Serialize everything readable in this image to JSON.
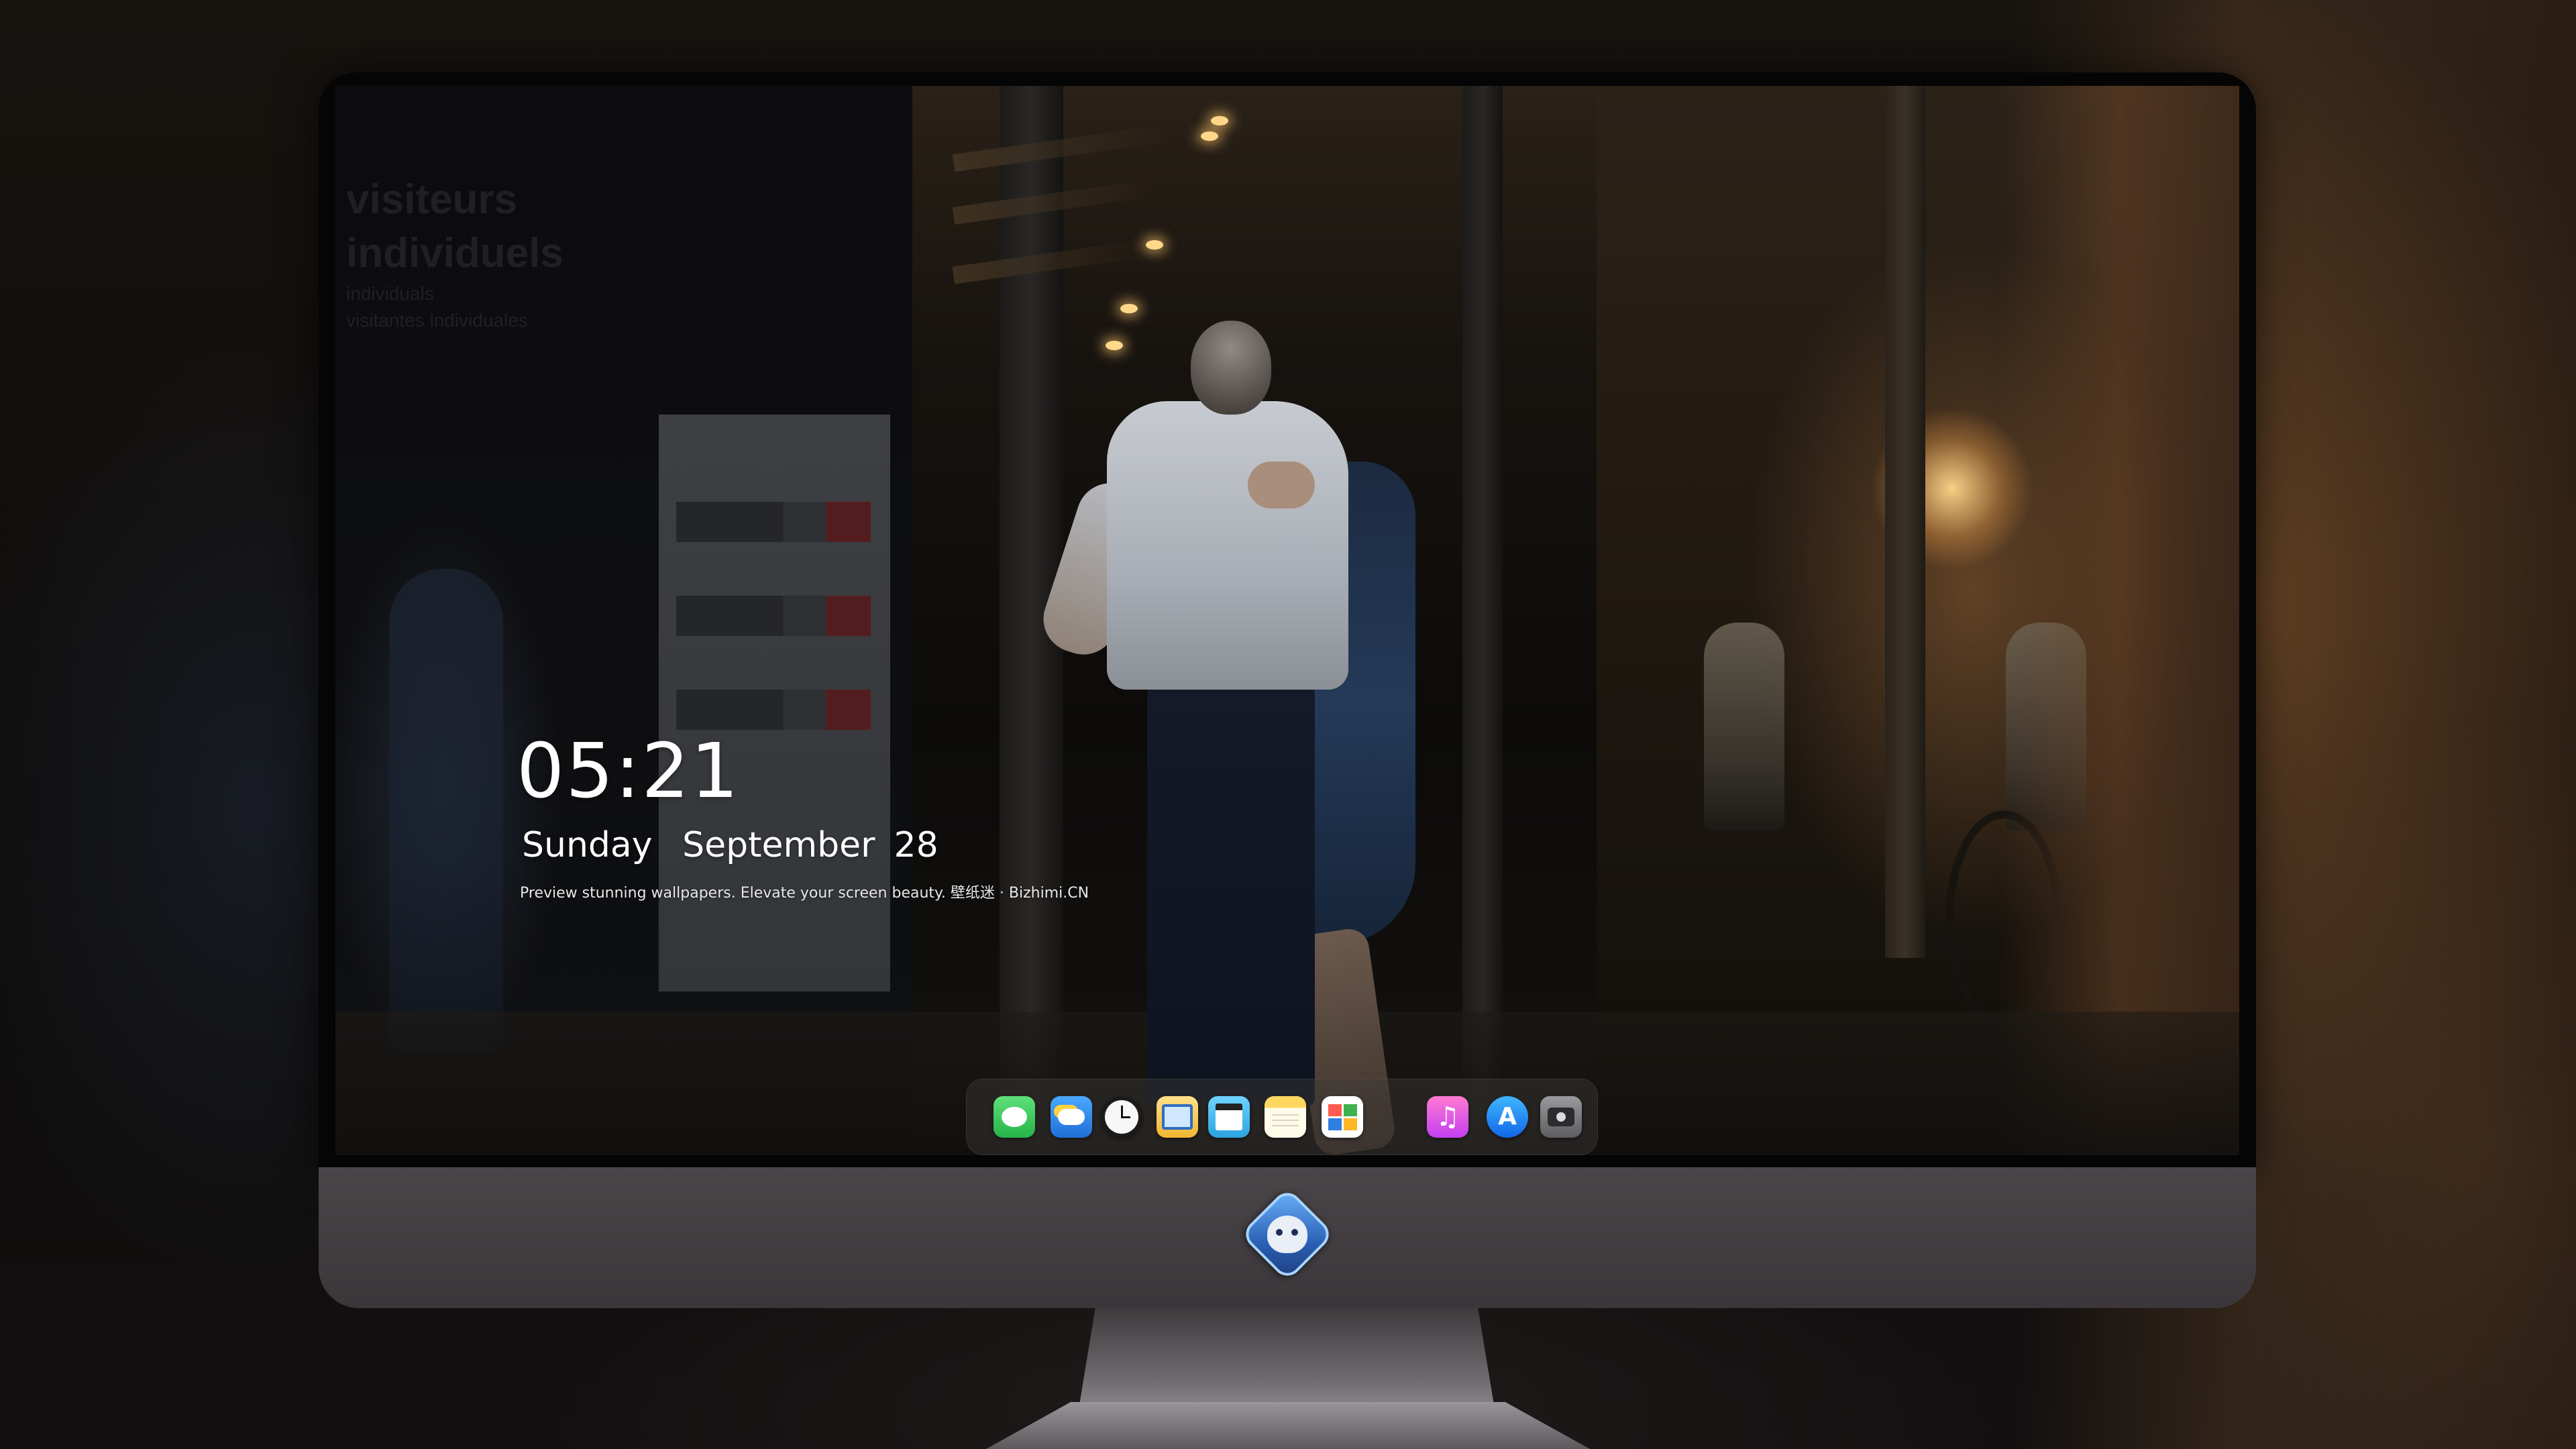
{
  "lock_screen": {
    "time": "05:21",
    "weekday": "Sunday",
    "month": "September",
    "day": "28",
    "tagline": "Preview stunning wallpapers. Elevate your screen beauty. 壁纸迷 · Bizhimi.CN"
  },
  "wallpaper": {
    "sign_text_line1": "visiteurs",
    "sign_text_line2": "individuels",
    "sign_text_line3": "individuals",
    "sign_text_line4": "visitantes individuales"
  },
  "dock": {
    "items": [
      {
        "name": "messages",
        "icon": "message-bubble-icon",
        "color": "#34c759"
      },
      {
        "name": "weather",
        "icon": "cloud-sun-icon",
        "color": "#2f8cf0"
      },
      {
        "name": "clock",
        "icon": "clock-icon",
        "color": "#f2f2f2"
      },
      {
        "name": "preview",
        "icon": "preview-icon",
        "color": "#f5c542"
      },
      {
        "name": "clips",
        "icon": "clapperboard-icon",
        "color": "#4fc3f7"
      },
      {
        "name": "notes",
        "icon": "notes-icon",
        "color": "#fde68a"
      },
      {
        "name": "photo-booth",
        "icon": "photo-grid-icon",
        "color": "#e74c3c"
      },
      {
        "name": "music",
        "icon": "music-note-icon",
        "color": "#ff4fa3"
      },
      {
        "name": "app-store",
        "icon": "app-store-icon",
        "color": "#1e90ff"
      },
      {
        "name": "camera",
        "icon": "camera-icon",
        "color": "#8e8e93"
      }
    ]
  }
}
